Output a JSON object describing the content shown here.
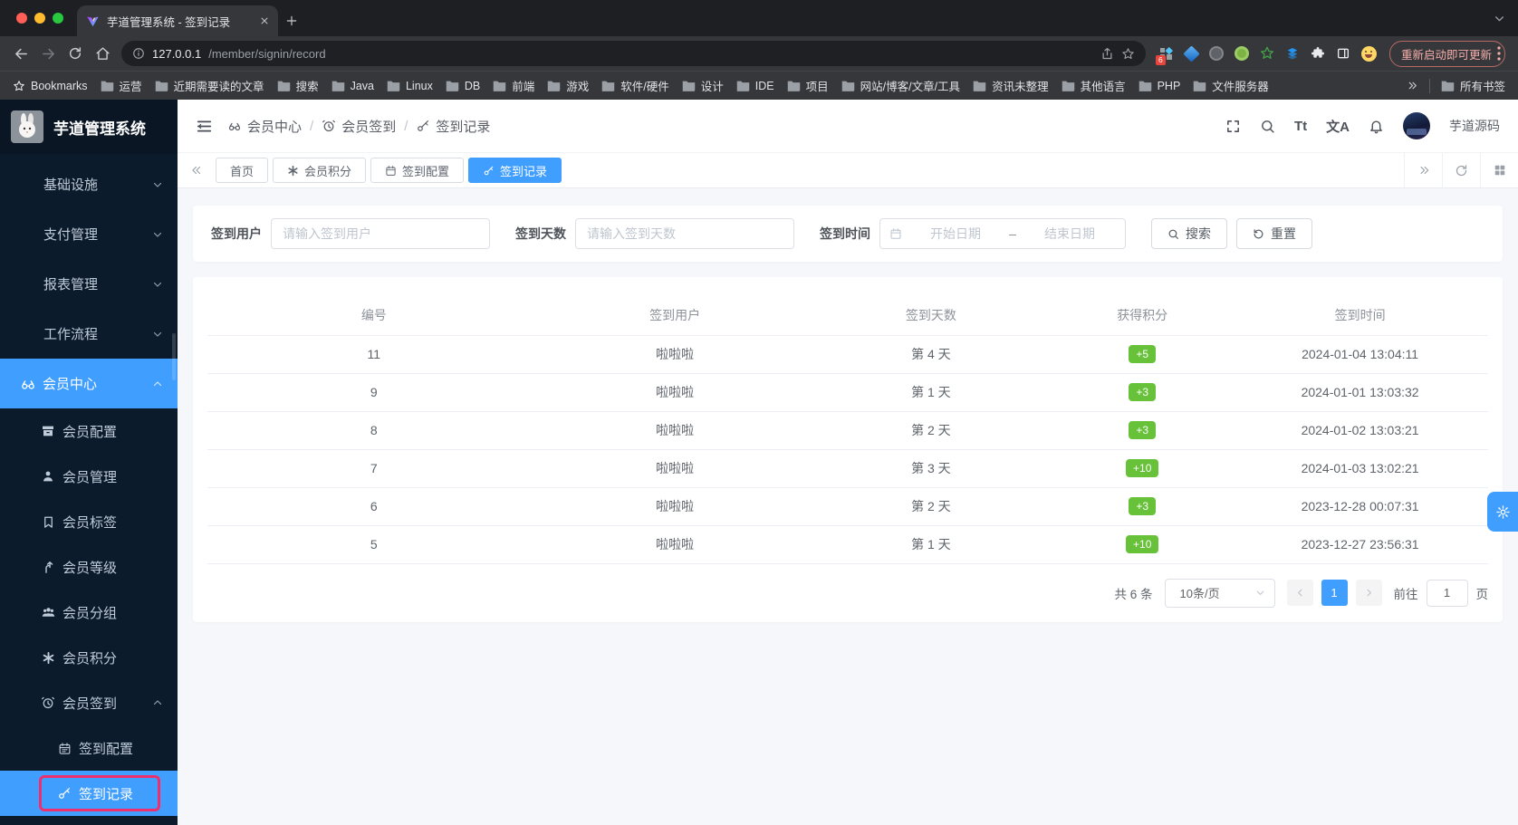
{
  "colors": {
    "accent": "#409eff",
    "success_badge": "#67c23a",
    "sidebar_bg": "#0c1b2b",
    "highlight_box": "#ee2f6e",
    "chrome_bg": "#36373b",
    "update_pill": "#f6aea9"
  },
  "icons": {
    "search-icon": "magnifier",
    "bell-icon": "bell",
    "fullscreen-icon": "corner brackets",
    "member-icon": "linked rings",
    "clock-icon": "alarm clock",
    "link-icon": "key",
    "calendar-icon": "calendar",
    "points-icon": "asterisk",
    "gear-icon": "gear",
    "folder-icon": "folder",
    "star-icon": "star",
    "refresh-icon": "circular arrow",
    "grid-icon": "four squares"
  },
  "browser": {
    "tab_title": "芋道管理系统 - 签到记录",
    "url_host": "127.0.0.1",
    "url_path": "/member/signin/record",
    "extension_badge": "6",
    "update_button": "重新启动即可更新",
    "bookmarks_label": "Bookmarks",
    "bookmarks": [
      "运营",
      "近期需要读的文章",
      "搜索",
      "Java",
      "Linux",
      "DB",
      "前端",
      "游戏",
      "软件/硬件",
      "设计",
      "IDE",
      "项目",
      "网站/博客/文章/工具",
      "资讯未整理",
      "其他语言",
      "PHP",
      "文件服务器"
    ],
    "all_bookmarks": "所有书签"
  },
  "sidebar": {
    "logo_title": "芋道管理系统",
    "items": [
      {
        "label": "基础设施"
      },
      {
        "label": "支付管理"
      },
      {
        "label": "报表管理"
      },
      {
        "label": "工作流程"
      },
      {
        "label": "会员中心"
      },
      {
        "label": "会员配置"
      },
      {
        "label": "会员管理"
      },
      {
        "label": "会员标签"
      },
      {
        "label": "会员等级"
      },
      {
        "label": "会员分组"
      },
      {
        "label": "会员积分"
      },
      {
        "label": "会员签到"
      },
      {
        "label": "签到配置"
      },
      {
        "label": "签到记录"
      }
    ]
  },
  "header": {
    "breadcrumb": [
      {
        "label": "会员中心"
      },
      {
        "label": "会员签到"
      },
      {
        "label": "签到记录"
      }
    ],
    "sep": "/",
    "font_icon": "Tt",
    "lang_icon": "文A",
    "user_name": "芋道源码"
  },
  "tabs": [
    {
      "label": "首页"
    },
    {
      "label": "会员积分"
    },
    {
      "label": "签到配置"
    },
    {
      "label": "签到记录"
    }
  ],
  "filters": {
    "user_label": "签到用户",
    "user_placeholder": "请输入签到用户",
    "days_label": "签到天数",
    "days_placeholder": "请输入签到天数",
    "time_label": "签到时间",
    "start_placeholder": "开始日期",
    "range_sep": "–",
    "end_placeholder": "结束日期",
    "search_label": "搜索",
    "reset_label": "重置"
  },
  "table": {
    "columns": [
      "编号",
      "签到用户",
      "签到天数",
      "获得积分",
      "签到时间"
    ],
    "rows": [
      {
        "id": "11",
        "user": "啦啦啦",
        "day": "第 4 天",
        "points": "+5",
        "time": "2024-01-04 13:04:11"
      },
      {
        "id": "9",
        "user": "啦啦啦",
        "day": "第 1 天",
        "points": "+3",
        "time": "2024-01-01 13:03:32"
      },
      {
        "id": "8",
        "user": "啦啦啦",
        "day": "第 2 天",
        "points": "+3",
        "time": "2024-01-02 13:03:21"
      },
      {
        "id": "7",
        "user": "啦啦啦",
        "day": "第 3 天",
        "points": "+10",
        "time": "2024-01-03 13:02:21"
      },
      {
        "id": "6",
        "user": "啦啦啦",
        "day": "第 2 天",
        "points": "+3",
        "time": "2023-12-28 00:07:31"
      },
      {
        "id": "5",
        "user": "啦啦啦",
        "day": "第 1 天",
        "points": "+10",
        "time": "2023-12-27 23:56:31"
      }
    ]
  },
  "pagination": {
    "total": "共 6 条",
    "page_size": "10条/页",
    "page": "1",
    "goto_label": "前往",
    "goto_value": "1",
    "unit": "页"
  }
}
